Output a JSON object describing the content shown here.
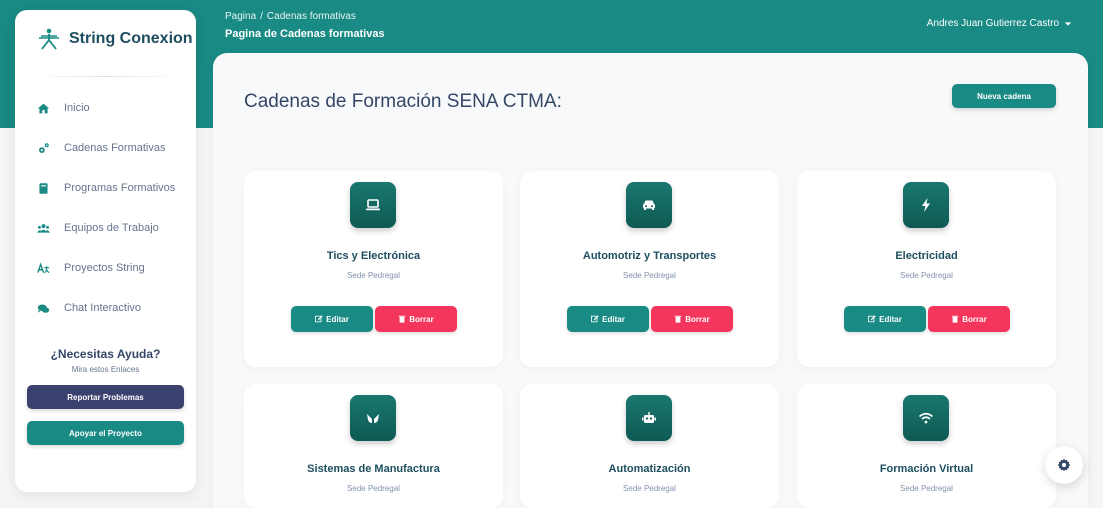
{
  "brand": {
    "name": "String Conexion"
  },
  "sidebar": {
    "items": [
      {
        "label": "Inicio",
        "icon": "home-icon"
      },
      {
        "label": "Cadenas Formativas",
        "icon": "gears-icon"
      },
      {
        "label": "Programas Formativos",
        "icon": "book-icon"
      },
      {
        "label": "Equipos de Trabajo",
        "icon": "users-icon"
      },
      {
        "label": "Proyectos String",
        "icon": "language-icon"
      },
      {
        "label": "Chat Interactivo",
        "icon": "comments-icon"
      }
    ],
    "help_title": "¿Necesitas Ayuda?",
    "help_subtitle": "Mira estos Enlaces",
    "report_label": "Reportar Problemas",
    "support_label": "Apoyar el Proyecto"
  },
  "header": {
    "breadcrumb_root": "Pagina",
    "breadcrumb_separator": "/",
    "breadcrumb_current": "Cadenas formativas",
    "page_title": "Pagina de Cadenas formativas",
    "user_name": "Andres Juan Gutierrez Castro"
  },
  "main": {
    "title": "Cadenas de Formación SENA CTMA:",
    "new_button": "Nueva cadena",
    "edit_label": "Editar",
    "delete_label": "Borrar",
    "cards": [
      {
        "title": "Tics y Electrónica",
        "subtitle": "Sede Pedregal",
        "icon": "laptop-icon"
      },
      {
        "title": "Automotriz y Transportes",
        "subtitle": "Sede Pedregal",
        "icon": "car-icon"
      },
      {
        "title": "Electricidad",
        "subtitle": "Sede Pedregal",
        "icon": "bolt-icon"
      },
      {
        "title": "Sistemas de Manufactura",
        "subtitle": "Sede Pedregal",
        "icon": "hands-icon"
      },
      {
        "title": "Automatización",
        "subtitle": "Sede Pedregal",
        "icon": "robot-icon"
      },
      {
        "title": "Formación Virtual",
        "subtitle": "Sede Pedregal",
        "icon": "wifi-icon"
      }
    ]
  },
  "colors": {
    "primary": "#1a8a84",
    "danger": "#f5365c",
    "dark": "#3a416f"
  }
}
